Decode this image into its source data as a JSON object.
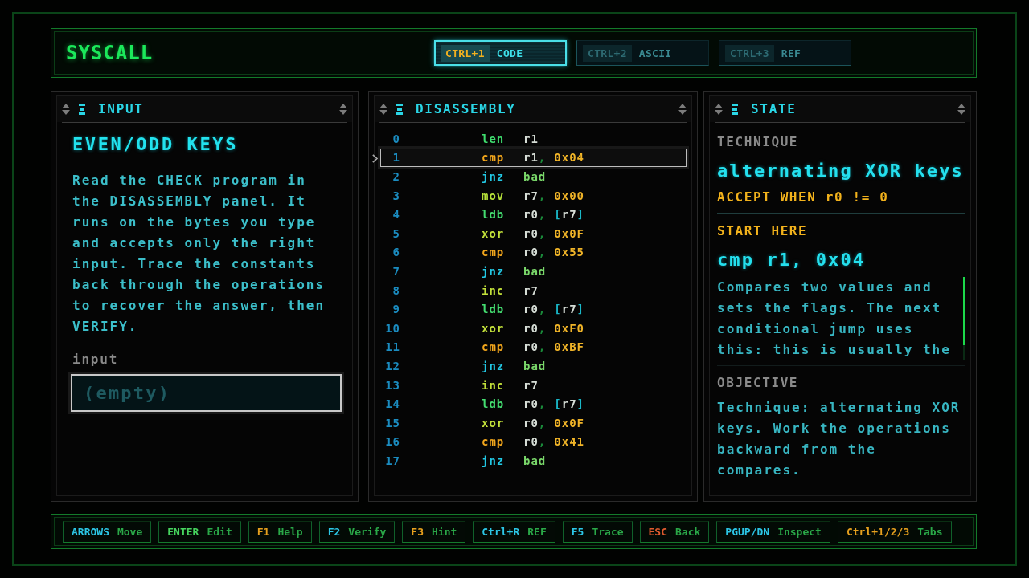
{
  "app": {
    "title": "SYSCALL"
  },
  "tabs": [
    {
      "key": "CTRL+1",
      "label": "CODE",
      "selected": true
    },
    {
      "key": "CTRL+2",
      "label": "ASCII",
      "selected": false
    },
    {
      "key": "CTRL+3",
      "label": "REF",
      "selected": false
    }
  ],
  "input_panel": {
    "title": "INPUT",
    "heading": "EVEN/ODD KEYS",
    "description": "Read the CHECK program in the DISASSEMBLY panel. It runs on the bytes you type and accepts only the right input. Trace the constants back through the operations to recover the answer, then VERIFY.",
    "field_label": "input",
    "field": {
      "placeholder": "(empty)"
    }
  },
  "disassembly_panel": {
    "title": "DISASSEMBLY",
    "rows": [
      {
        "line": "0",
        "op": "len",
        "kind": "length",
        "selected": false,
        "operands": [
          {
            "text": "r1",
            "kind": "reg"
          }
        ]
      },
      {
        "line": "1",
        "op": "cmp",
        "kind": "compare",
        "selected": true,
        "operands": [
          {
            "text": "r1",
            "kind": "reg"
          },
          {
            "text": ",",
            "kind": "sep"
          },
          {
            "text": "0x04",
            "kind": "imm"
          }
        ]
      },
      {
        "line": "2",
        "op": "jnz",
        "kind": "branch",
        "selected": false,
        "operands": [
          {
            "text": "bad",
            "kind": "label"
          }
        ]
      },
      {
        "line": "3",
        "op": "mov",
        "kind": "move",
        "selected": false,
        "operands": [
          {
            "text": "r7",
            "kind": "reg"
          },
          {
            "text": ",",
            "kind": "sep"
          },
          {
            "text": "0x00",
            "kind": "imm"
          }
        ]
      },
      {
        "line": "4",
        "op": "ldb",
        "kind": "load",
        "selected": false,
        "operands": [
          {
            "text": "r0",
            "kind": "reg"
          },
          {
            "text": ",",
            "kind": "sep"
          },
          {
            "text": "[",
            "kind": "bracket"
          },
          {
            "text": "r7",
            "kind": "reg"
          },
          {
            "text": "]",
            "kind": "bracket"
          }
        ]
      },
      {
        "line": "5",
        "op": "xor",
        "kind": "alu",
        "selected": false,
        "operands": [
          {
            "text": "r0",
            "kind": "reg"
          },
          {
            "text": ",",
            "kind": "sep"
          },
          {
            "text": "0x0F",
            "kind": "imm"
          }
        ]
      },
      {
        "line": "6",
        "op": "cmp",
        "kind": "compare",
        "selected": false,
        "operands": [
          {
            "text": "r0",
            "kind": "reg"
          },
          {
            "text": ",",
            "kind": "sep"
          },
          {
            "text": "0x55",
            "kind": "imm"
          }
        ]
      },
      {
        "line": "7",
        "op": "jnz",
        "kind": "branch",
        "selected": false,
        "operands": [
          {
            "text": "bad",
            "kind": "label"
          }
        ]
      },
      {
        "line": "8",
        "op": "inc",
        "kind": "alu",
        "selected": false,
        "operands": [
          {
            "text": "r7",
            "kind": "reg"
          }
        ]
      },
      {
        "line": "9",
        "op": "ldb",
        "kind": "load",
        "selected": false,
        "operands": [
          {
            "text": "r0",
            "kind": "reg"
          },
          {
            "text": ",",
            "kind": "sep"
          },
          {
            "text": "[",
            "kind": "bracket"
          },
          {
            "text": "r7",
            "kind": "reg"
          },
          {
            "text": "]",
            "kind": "bracket"
          }
        ]
      },
      {
        "line": "10",
        "op": "xor",
        "kind": "alu",
        "selected": false,
        "operands": [
          {
            "text": "r0",
            "kind": "reg"
          },
          {
            "text": ",",
            "kind": "sep"
          },
          {
            "text": "0xF0",
            "kind": "imm"
          }
        ]
      },
      {
        "line": "11",
        "op": "cmp",
        "kind": "compare",
        "selected": false,
        "operands": [
          {
            "text": "r0",
            "kind": "reg"
          },
          {
            "text": ",",
            "kind": "sep"
          },
          {
            "text": "0xBF",
            "kind": "imm"
          }
        ]
      },
      {
        "line": "12",
        "op": "jnz",
        "kind": "branch",
        "selected": false,
        "operands": [
          {
            "text": "bad",
            "kind": "label"
          }
        ]
      },
      {
        "line": "13",
        "op": "inc",
        "kind": "alu",
        "selected": false,
        "operands": [
          {
            "text": "r7",
            "kind": "reg"
          }
        ]
      },
      {
        "line": "14",
        "op": "ldb",
        "kind": "load",
        "selected": false,
        "operands": [
          {
            "text": "r0",
            "kind": "reg"
          },
          {
            "text": ",",
            "kind": "sep"
          },
          {
            "text": "[",
            "kind": "bracket"
          },
          {
            "text": "r7",
            "kind": "reg"
          },
          {
            "text": "]",
            "kind": "bracket"
          }
        ]
      },
      {
        "line": "15",
        "op": "xor",
        "kind": "alu",
        "selected": false,
        "operands": [
          {
            "text": "r0",
            "kind": "reg"
          },
          {
            "text": ",",
            "kind": "sep"
          },
          {
            "text": "0x0F",
            "kind": "imm"
          }
        ]
      },
      {
        "line": "16",
        "op": "cmp",
        "kind": "compare",
        "selected": false,
        "operands": [
          {
            "text": "r0",
            "kind": "reg"
          },
          {
            "text": ",",
            "kind": "sep"
          },
          {
            "text": "0x41",
            "kind": "imm"
          }
        ]
      },
      {
        "line": "17",
        "op": "jnz",
        "kind": "branch",
        "selected": false,
        "operands": [
          {
            "text": "bad",
            "kind": "label"
          }
        ]
      }
    ]
  },
  "state_panel": {
    "title": "STATE",
    "technique_label": "TECHNIQUE",
    "technique": "alternating XOR keys",
    "accept_condition": "ACCEPT WHEN r0 != 0",
    "start_label": "START HERE",
    "start_instruction": "cmp r1, 0x04",
    "start_description": "Compares two values and sets the flags. The next conditional jump uses this: this is usually the",
    "objective_label": "OBJECTIVE",
    "objective": "Technique: alternating XOR keys. Work the operations backward from the compares."
  },
  "shortcuts": [
    {
      "key": "ARROWS",
      "action": "Move",
      "color": "#2cc6e6"
    },
    {
      "key": "ENTER",
      "action": "Edit",
      "color": "#46d45e"
    },
    {
      "key": "F1",
      "action": "Help",
      "color": "#e6a01e"
    },
    {
      "key": "F2",
      "action": "Verify",
      "color": "#2cc6e6"
    },
    {
      "key": "F3",
      "action": "Hint",
      "color": "#e6a01e"
    },
    {
      "key": "Ctrl+R",
      "action": "REF",
      "color": "#2cc6e6"
    },
    {
      "key": "F5",
      "action": "Trace",
      "color": "#2cc6e6"
    },
    {
      "key": "ESC",
      "action": "Back",
      "color": "#de5a2e"
    },
    {
      "key": "PGUP/DN",
      "action": "Inspect",
      "color": "#2cc6e6"
    },
    {
      "key": "Ctrl+1/2/3",
      "action": "Tabs",
      "color": "#e6a01e"
    }
  ]
}
